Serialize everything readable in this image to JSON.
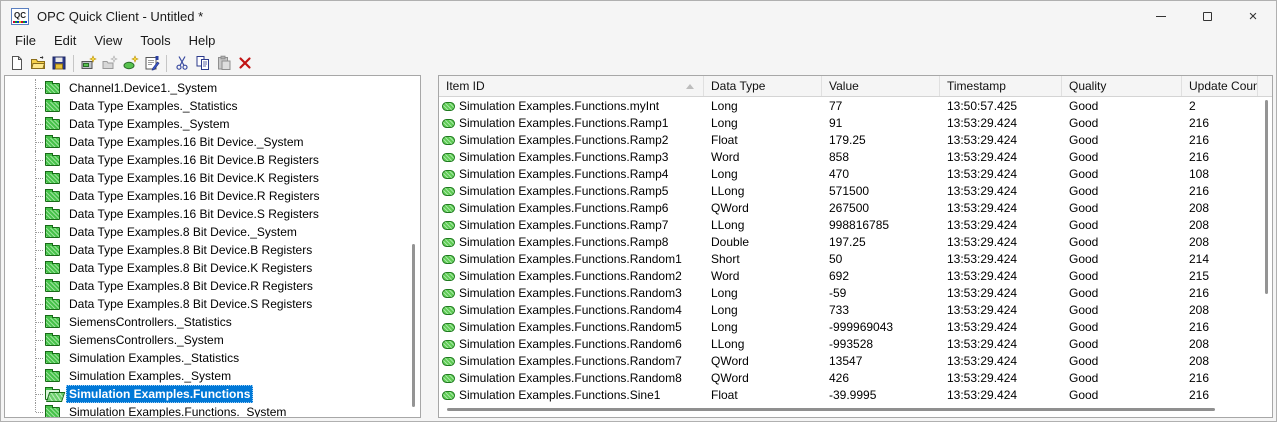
{
  "window": {
    "title": "OPC Quick Client - Untitled *",
    "app_icon_label": "QC",
    "controls": [
      "minimize",
      "maximize",
      "close"
    ]
  },
  "menu": {
    "items": [
      "File",
      "Edit",
      "View",
      "Tools",
      "Help"
    ]
  },
  "toolbar": {
    "buttons": [
      {
        "name": "new-file-icon",
        "enabled": true
      },
      {
        "name": "open-file-icon",
        "enabled": true
      },
      {
        "name": "save-icon",
        "enabled": true
      },
      {
        "name": "new-server-connection-icon",
        "enabled": true
      },
      {
        "name": "new-group-icon",
        "enabled": false
      },
      {
        "name": "new-item-icon",
        "enabled": true
      },
      {
        "name": "properties-icon",
        "enabled": true
      },
      {
        "name": "cut-icon",
        "enabled": true
      },
      {
        "name": "copy-icon",
        "enabled": true
      },
      {
        "name": "paste-icon",
        "enabled": false
      },
      {
        "name": "delete-icon",
        "enabled": true
      }
    ]
  },
  "colors": {
    "selection_blue": "#0078d7",
    "folder_green": "#46c24a",
    "quality_good_text": "#000000",
    "delete_red": "#c11414"
  },
  "tree": {
    "items": [
      {
        "label": "Channel1.Device1._System",
        "selected": false
      },
      {
        "label": "Data Type Examples._Statistics",
        "selected": false
      },
      {
        "label": "Data Type Examples._System",
        "selected": false
      },
      {
        "label": "Data Type Examples.16 Bit Device._System",
        "selected": false
      },
      {
        "label": "Data Type Examples.16 Bit Device.B Registers",
        "selected": false
      },
      {
        "label": "Data Type Examples.16 Bit Device.K Registers",
        "selected": false
      },
      {
        "label": "Data Type Examples.16 Bit Device.R Registers",
        "selected": false
      },
      {
        "label": "Data Type Examples.16 Bit Device.S Registers",
        "selected": false
      },
      {
        "label": "Data Type Examples.8 Bit Device._System",
        "selected": false
      },
      {
        "label": "Data Type Examples.8 Bit Device.B Registers",
        "selected": false
      },
      {
        "label": "Data Type Examples.8 Bit Device.K Registers",
        "selected": false
      },
      {
        "label": "Data Type Examples.8 Bit Device.R Registers",
        "selected": false
      },
      {
        "label": "Data Type Examples.8 Bit Device.S Registers",
        "selected": false
      },
      {
        "label": "SiemensControllers._Statistics",
        "selected": false
      },
      {
        "label": "SiemensControllers._System",
        "selected": false
      },
      {
        "label": "Simulation Examples._Statistics",
        "selected": false
      },
      {
        "label": "Simulation Examples._System",
        "selected": false
      },
      {
        "label": "Simulation Examples.Functions",
        "selected": true,
        "open": true
      },
      {
        "label": "Simulation Examples.Functions._System",
        "selected": false
      }
    ]
  },
  "table": {
    "columns": [
      "Item ID",
      "Data Type",
      "Value",
      "Timestamp",
      "Quality",
      "Update Count"
    ],
    "sort": {
      "column": "Item ID",
      "direction": "ascending"
    },
    "rows": [
      {
        "item_id": "Simulation Examples.Functions.myInt",
        "data_type": "Long",
        "value": "77",
        "timestamp": "13:50:57.425",
        "quality": "Good",
        "update_count": "2"
      },
      {
        "item_id": "Simulation Examples.Functions.Ramp1",
        "data_type": "Long",
        "value": "91",
        "timestamp": "13:53:29.424",
        "quality": "Good",
        "update_count": "216"
      },
      {
        "item_id": "Simulation Examples.Functions.Ramp2",
        "data_type": "Float",
        "value": "179.25",
        "timestamp": "13:53:29.424",
        "quality": "Good",
        "update_count": "216"
      },
      {
        "item_id": "Simulation Examples.Functions.Ramp3",
        "data_type": "Word",
        "value": "858",
        "timestamp": "13:53:29.424",
        "quality": "Good",
        "update_count": "216"
      },
      {
        "item_id": "Simulation Examples.Functions.Ramp4",
        "data_type": "Long",
        "value": "470",
        "timestamp": "13:53:29.424",
        "quality": "Good",
        "update_count": "108"
      },
      {
        "item_id": "Simulation Examples.Functions.Ramp5",
        "data_type": "LLong",
        "value": "571500",
        "timestamp": "13:53:29.424",
        "quality": "Good",
        "update_count": "216"
      },
      {
        "item_id": "Simulation Examples.Functions.Ramp6",
        "data_type": "QWord",
        "value": "267500",
        "timestamp": "13:53:29.424",
        "quality": "Good",
        "update_count": "208"
      },
      {
        "item_id": "Simulation Examples.Functions.Ramp7",
        "data_type": "LLong",
        "value": "998816785",
        "timestamp": "13:53:29.424",
        "quality": "Good",
        "update_count": "208"
      },
      {
        "item_id": "Simulation Examples.Functions.Ramp8",
        "data_type": "Double",
        "value": "197.25",
        "timestamp": "13:53:29.424",
        "quality": "Good",
        "update_count": "208"
      },
      {
        "item_id": "Simulation Examples.Functions.Random1",
        "data_type": "Short",
        "value": "50",
        "timestamp": "13:53:29.424",
        "quality": "Good",
        "update_count": "214"
      },
      {
        "item_id": "Simulation Examples.Functions.Random2",
        "data_type": "Word",
        "value": "692",
        "timestamp": "13:53:29.424",
        "quality": "Good",
        "update_count": "215"
      },
      {
        "item_id": "Simulation Examples.Functions.Random3",
        "data_type": "Long",
        "value": "-59",
        "timestamp": "13:53:29.424",
        "quality": "Good",
        "update_count": "216"
      },
      {
        "item_id": "Simulation Examples.Functions.Random4",
        "data_type": "Long",
        "value": "733",
        "timestamp": "13:53:29.424",
        "quality": "Good",
        "update_count": "208"
      },
      {
        "item_id": "Simulation Examples.Functions.Random5",
        "data_type": "Long",
        "value": "-999969043",
        "timestamp": "13:53:29.424",
        "quality": "Good",
        "update_count": "216"
      },
      {
        "item_id": "Simulation Examples.Functions.Random6",
        "data_type": "LLong",
        "value": "-993528",
        "timestamp": "13:53:29.424",
        "quality": "Good",
        "update_count": "208"
      },
      {
        "item_id": "Simulation Examples.Functions.Random7",
        "data_type": "QWord",
        "value": "13547",
        "timestamp": "13:53:29.424",
        "quality": "Good",
        "update_count": "208"
      },
      {
        "item_id": "Simulation Examples.Functions.Random8",
        "data_type": "QWord",
        "value": "426",
        "timestamp": "13:53:29.424",
        "quality": "Good",
        "update_count": "216"
      },
      {
        "item_id": "Simulation Examples.Functions.Sine1",
        "data_type": "Float",
        "value": "-39.9995",
        "timestamp": "13:53:29.424",
        "quality": "Good",
        "update_count": "216"
      }
    ]
  }
}
